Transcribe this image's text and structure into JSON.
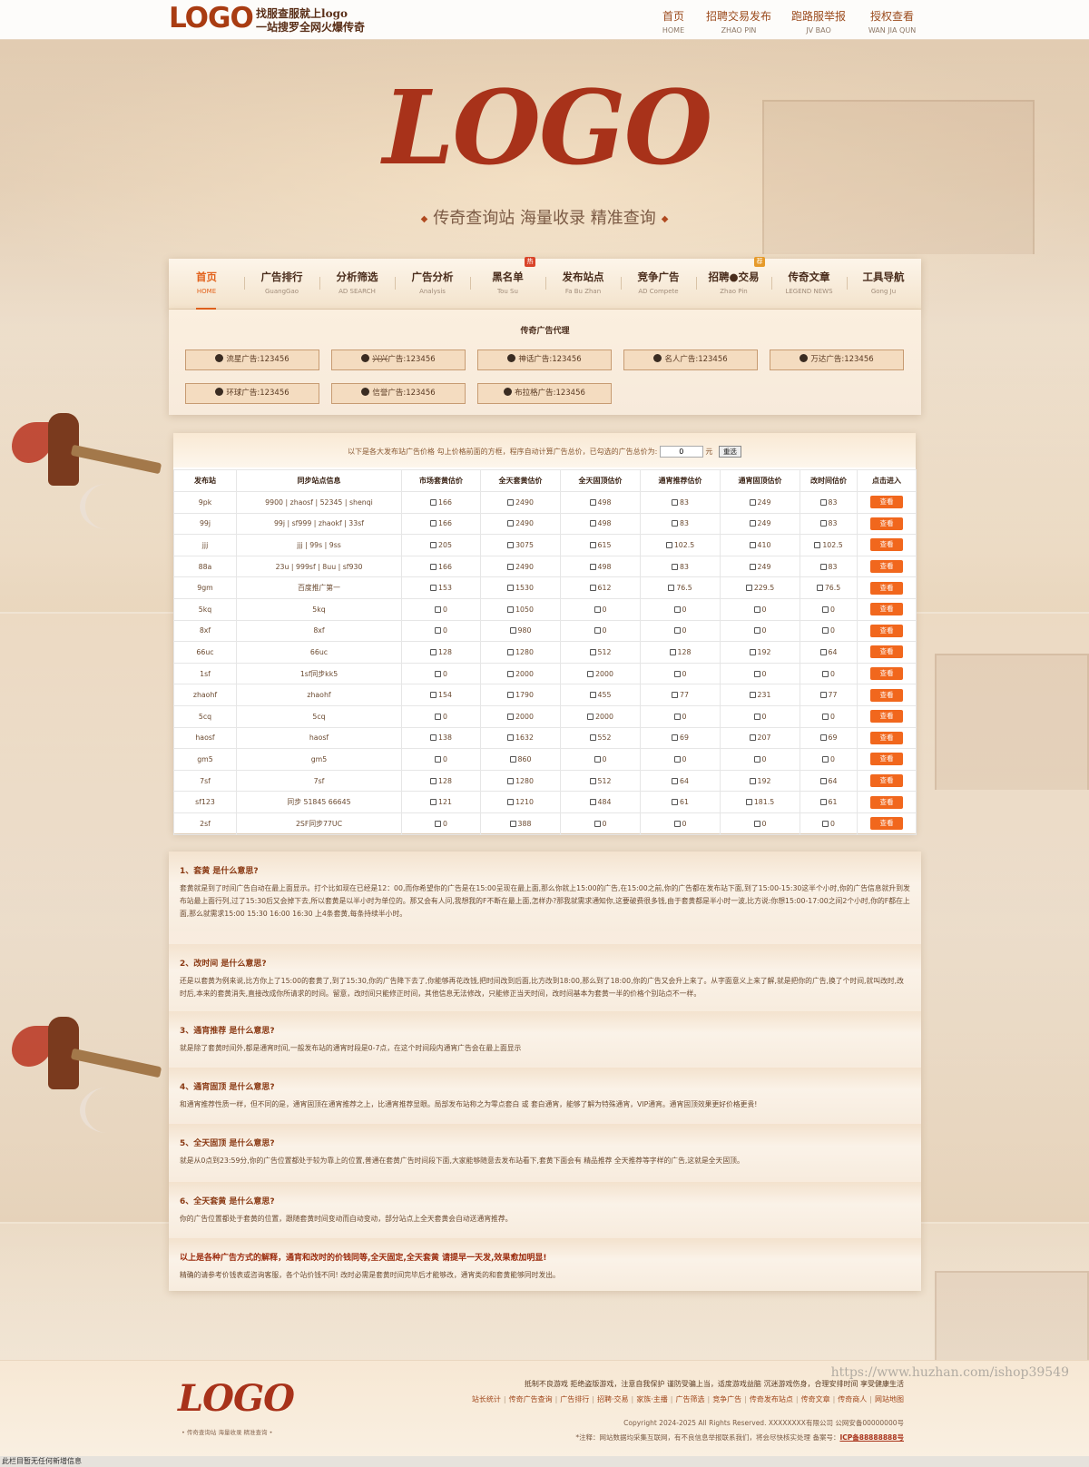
{
  "header": {
    "logo": "LOGO",
    "slogan_line1": "找服查服就上",
    "slogan_logo": "logo",
    "slogan_line2": "一站搜罗全网火爆传奇",
    "nav": [
      {
        "label": "首页",
        "sub": "HOME"
      },
      {
        "label": "招聘交易发布",
        "sub": "ZHAO PIN"
      },
      {
        "label": "跑路服举报",
        "sub": "JV BAO"
      },
      {
        "label": "授权查看",
        "sub": "WAN JIA QUN"
      }
    ]
  },
  "hero": {
    "logo": "LOGO",
    "subtitle": "传奇查询站  海量收录  精准查询"
  },
  "main_nav": [
    {
      "label": "首页",
      "sub": "HOME",
      "active": true
    },
    {
      "label": "广告排行",
      "sub": "GuangGao"
    },
    {
      "label": "分析筛选",
      "sub": "AD SEARCH"
    },
    {
      "label": "广告分析",
      "sub": "Analysis"
    },
    {
      "label": "黑名单",
      "sub": "Tou Su",
      "badge": "热"
    },
    {
      "label": "发布站点",
      "sub": "Fa Bu Zhan"
    },
    {
      "label": "竞争广告",
      "sub": "AD Compete"
    },
    {
      "label": "招聘●交易",
      "sub": "Zhao Pin",
      "badge": "荐"
    },
    {
      "label": "传奇文章",
      "sub": "LEGEND NEWS"
    },
    {
      "label": "工具导航",
      "sub": "Gong Ju"
    }
  ],
  "agents": {
    "title": "传奇广告代理",
    "items": [
      {
        "name": "流星",
        "text": "广告:123456"
      },
      {
        "name": "兴兴",
        "text": "广告:123456",
        "strike": true
      },
      {
        "name": "神话",
        "text": "广告:123456"
      },
      {
        "name": "名人",
        "text": "广告:123456"
      },
      {
        "name": "万达",
        "text": "广告:123456"
      },
      {
        "name": "环球",
        "text": "广告:123456"
      },
      {
        "name": "信誉",
        "text": "广告:123456"
      },
      {
        "name": "布拉格",
        "text": "广告:123456"
      }
    ]
  },
  "price": {
    "note_prefix": "以下是各大发布站广告价格 勾上价格前面的方框，程序自动计算广告总价，已勾选的广告总价为:",
    "total_value": "0",
    "unit": "元",
    "reset_label": "重选",
    "columns": [
      "发布站",
      "同步站点信息",
      "市场套黄估价",
      "全天套黄估价",
      "全天固顶估价",
      "通宵推荐估价",
      "通宵固顶估价",
      "改时间估价",
      "点击进入"
    ],
    "button_label": "查看",
    "rows": [
      [
        "9pk",
        "9900 | zhaosf | 52345 | shenqi",
        "166",
        "2490",
        "498",
        "83",
        "249",
        "83"
      ],
      [
        "99j",
        "99j | sf999 | zhaokf | 33sf",
        "166",
        "2490",
        "498",
        "83",
        "249",
        "83"
      ],
      [
        "jjj",
        "jjj | 99s | 9ss",
        "205",
        "3075",
        "615",
        "102.5",
        "410",
        "102.5"
      ],
      [
        "88a",
        "23u | 999sf | 8uu | sf930",
        "166",
        "2490",
        "498",
        "83",
        "249",
        "83"
      ],
      [
        "9gm",
        "百度推广第一",
        "153",
        "1530",
        "612",
        "76.5",
        "229.5",
        "76.5"
      ],
      [
        "5kq",
        "5kq",
        "0",
        "1050",
        "0",
        "0",
        "0",
        "0"
      ],
      [
        "8xf",
        "8xf",
        "0",
        "980",
        "0",
        "0",
        "0",
        "0"
      ],
      [
        "66uc",
        "66uc",
        "128",
        "1280",
        "512",
        "128",
        "192",
        "64"
      ],
      [
        "1sf",
        "1sf同步kk5",
        "0",
        "2000",
        "2000",
        "0",
        "0",
        "0"
      ],
      [
        "zhaohf",
        "zhaohf",
        "154",
        "1790",
        "455",
        "77",
        "231",
        "77"
      ],
      [
        "5cq",
        "5cq",
        "0",
        "2000",
        "2000",
        "0",
        "0",
        "0"
      ],
      [
        "haosf",
        "haosf",
        "138",
        "1632",
        "552",
        "69",
        "207",
        "69"
      ],
      [
        "gm5",
        "gm5",
        "0",
        "860",
        "0",
        "0",
        "0",
        "0"
      ],
      [
        "7sf",
        "7sf",
        "128",
        "1280",
        "512",
        "64",
        "192",
        "64"
      ],
      [
        "sf123",
        "同步 51845 66645",
        "121",
        "1210",
        "484",
        "61",
        "181.5",
        "61"
      ],
      [
        "2sf",
        "2SF同步77UC",
        "0",
        "388",
        "0",
        "0",
        "0",
        "0"
      ]
    ]
  },
  "faq": [
    {
      "q": "1、套黄 是什么意思?",
      "a": "套黄就是到了时间广告自动在最上面显示。打个比如现在已经是12：00,而你希望你的广告是在15:00呈现在最上面,那么你就上15:00的广告,在15:00之前,你的广告都在发布站下面,到了15:00-15:30这半个小时,你的广告信息就升到发布站最上面行列,过了15:30后又会掉下去,所以套黄是以半小时为单位的。那又会有人问,我想我的F不断在最上面,怎样办?那我就需求通知你,这要破费很多钱,由于套黄都是半小时一波,比方说:你想15:00-17:00之间2个小时,你的F都在上面,那么就需求15:00 15:30 16:00 16:30 上4条套黄,每条持续半小时。"
    },
    {
      "q": "2、改时间 是什么意思?",
      "a": "还是以套黄为例来说,比方你上了15:00的套黄了,到了15:30,你的广告降下去了,你能够再花改钱,把时间改到后面,比方改到18:00,那么到了18:00,你的广告又会升上来了。从字面意义上来了解,就是把你的广告,换了个时间,就叫改时,改时后,本来的套黄消失,直接改成你所请求的时间。留意，改时间只能修正时间，其他信息无法修改，只能修正当天时间，改时间基本为套黄一半的价格个别站点不一样。"
    },
    {
      "q": "3、通宵推荐 是什么意思?",
      "a": "就是除了套黄时间外,都是通宵时间,一般发布站的通宵时段是0-7点，在这个时间段内通宵广告会在最上面显示"
    },
    {
      "q": "4、通宵固顶 是什么意思?",
      "a": "和通宵推荐性质一样，但不同的是，通宵固顶在通宵推荐之上，比通宵推荐显眼。局部发布站称之为零点套白 或 套白通宵，能够了解为特殊通宵，VIP通宵。通宵固顶效果更好价格更贵!"
    },
    {
      "q": "5、全天固顶 是什么意思?",
      "a": "就是从0点到23:59分,你的广告位置都处于较为靠上的位置,普通在套黄广告时间段下面,大家能够随意去发布站看下,套黄下面会有 精品推荐 全天推荐等字样的广告,这就是全天固顶。"
    },
    {
      "q": "6、全天套黄 是什么意思?",
      "a": "你的广告位置都处于套黄的位置，跟随套黄时间变动而自动变动，部分站点上全天套黄会自动送通宵推荐。"
    },
    {
      "q": "以上是各种广告方式的解释，通宵和改时的价钱同等,全天固定,全天套黄 请提早一天发,效果愈加明显!",
      "a": "精确的请参考价钱表或咨询客服，各个站价钱不同! 改时必需是套黄时间完毕后才能够改，通宵类的和套黄能够同时发出。"
    }
  ],
  "footer": {
    "logo": "LOGO",
    "slogan": "• 传奇查询站  海量收录  精准查询 •",
    "notice": "抵制不良游戏 拒绝盗版游戏，注意自我保护 谨防受骗上当，适度游戏益脑 沉迷游戏伤身，合理安排时间 享受健康生活",
    "links": [
      "站长统计",
      "传奇广告查询",
      "广告排行",
      "招聘·交易",
      "家族·主播",
      "广告筛选",
      "竞争广告",
      "传奇发布站点",
      "传奇文章",
      "传奇商人",
      "网站地图"
    ],
    "copyright": "Copyright 2024-2025 All Rights Reserved. XXXXXXXX有限公司 公网安备00000000号",
    "disclaimer": "*注释：网站数据均采集互联网，有不良信息举报联系我们，将会尽快核实处理 备案号：",
    "icp": "ICP备88888888号"
  },
  "watermark": "https://www.huzhan.com/ishop39549",
  "statusbar": "此栏目暂无任何新增信息"
}
